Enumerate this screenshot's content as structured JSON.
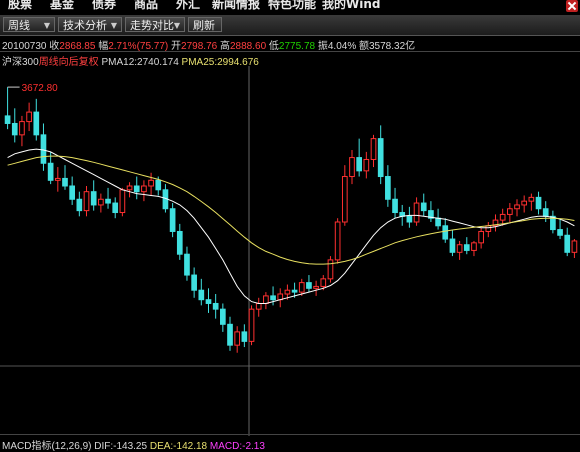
{
  "menu": [
    "股票",
    "基金",
    "债券",
    "商品",
    "外汇",
    "新闻情报",
    "特色功能",
    "我的Wind"
  ],
  "toolbar": {
    "period": "周线",
    "analysis": "技术分析",
    "compare": "走势对比",
    "refresh": "刷新"
  },
  "quote": {
    "date": "20100730",
    "close_label": "收",
    "close": "2868.85",
    "change_label": "幅",
    "change": "2.71%(75.77)",
    "open_label": "开",
    "open": "2798.76",
    "high_label": "高",
    "high": "2888.60",
    "low_label": "低",
    "low": "2775.78",
    "amp_label": "振",
    "amp": "4.04%",
    "amount_label": "额",
    "amount": "3578.32亿"
  },
  "indicator": {
    "name": "沪深300",
    "adjust": "周线向后复权",
    "pma12": "PMA12:2740.174",
    "pma25": "PMA25:2994.676"
  },
  "macd": {
    "label": "MACD指标(12,26,9)",
    "dif": "DIF:-143.25",
    "dea": "DEA:-142.18",
    "macd": "MACD:-2.13"
  },
  "chart_data": {
    "type": "candlestick",
    "title": "沪深300",
    "max_label": "3672.80",
    "colors": {
      "up": "#ff3030",
      "down": "#40e0e0",
      "ma12": "#ffffff",
      "ma25": "#e8e060",
      "crosshair": "#666666"
    },
    "ylim": [
      2200,
      3720
    ],
    "candles": [
      [
        3520,
        3672,
        3450,
        3480
      ],
      [
        3480,
        3560,
        3380,
        3420
      ],
      [
        3420,
        3520,
        3360,
        3490
      ],
      [
        3490,
        3590,
        3440,
        3540
      ],
      [
        3540,
        3610,
        3390,
        3420
      ],
      [
        3420,
        3480,
        3230,
        3270
      ],
      [
        3270,
        3330,
        3160,
        3180
      ],
      [
        3180,
        3250,
        3120,
        3190
      ],
      [
        3190,
        3260,
        3130,
        3150
      ],
      [
        3150,
        3200,
        3050,
        3080
      ],
      [
        3080,
        3120,
        2990,
        3020
      ],
      [
        3020,
        3150,
        2990,
        3120
      ],
      [
        3120,
        3180,
        3020,
        3050
      ],
      [
        3050,
        3110,
        3010,
        3080
      ],
      [
        3080,
        3140,
        3030,
        3060
      ],
      [
        3060,
        3090,
        2980,
        3010
      ],
      [
        3010,
        3140,
        2990,
        3130
      ],
      [
        3130,
        3170,
        3090,
        3150
      ],
      [
        3150,
        3200,
        3080,
        3120
      ],
      [
        3120,
        3180,
        3070,
        3150
      ],
      [
        3150,
        3220,
        3100,
        3180
      ],
      [
        3180,
        3200,
        3100,
        3130
      ],
      [
        3130,
        3160,
        3010,
        3030
      ],
      [
        3030,
        3060,
        2880,
        2910
      ],
      [
        2910,
        2950,
        2760,
        2790
      ],
      [
        2790,
        2830,
        2650,
        2680
      ],
      [
        2680,
        2720,
        2560,
        2600
      ],
      [
        2600,
        2660,
        2520,
        2550
      ],
      [
        2550,
        2610,
        2480,
        2530
      ],
      [
        2530,
        2580,
        2450,
        2500
      ],
      [
        2500,
        2530,
        2380,
        2420
      ],
      [
        2420,
        2460,
        2280,
        2310
      ],
      [
        2310,
        2410,
        2270,
        2380
      ],
      [
        2380,
        2420,
        2300,
        2330
      ],
      [
        2330,
        2520,
        2310,
        2500
      ],
      [
        2500,
        2560,
        2460,
        2530
      ],
      [
        2530,
        2590,
        2500,
        2570
      ],
      [
        2570,
        2620,
        2520,
        2550
      ],
      [
        2550,
        2610,
        2510,
        2580
      ],
      [
        2580,
        2630,
        2550,
        2600
      ],
      [
        2600,
        2640,
        2560,
        2590
      ],
      [
        2590,
        2660,
        2570,
        2640
      ],
      [
        2640,
        2680,
        2590,
        2610
      ],
      [
        2610,
        2650,
        2570,
        2620
      ],
      [
        2620,
        2680,
        2600,
        2660
      ],
      [
        2660,
        2780,
        2640,
        2760
      ],
      [
        2760,
        2980,
        2740,
        2960
      ],
      [
        2960,
        3260,
        2940,
        3200
      ],
      [
        3200,
        3340,
        3160,
        3300
      ],
      [
        3300,
        3400,
        3200,
        3230
      ],
      [
        3230,
        3330,
        3190,
        3290
      ],
      [
        3290,
        3420,
        3250,
        3400
      ],
      [
        3400,
        3470,
        3160,
        3200
      ],
      [
        3200,
        3260,
        3040,
        3080
      ],
      [
        3080,
        3140,
        2980,
        3010
      ],
      [
        3010,
        3050,
        2940,
        2990
      ],
      [
        2990,
        3040,
        2930,
        2960
      ],
      [
        2960,
        3090,
        2940,
        3060
      ],
      [
        3060,
        3110,
        2990,
        3020
      ],
      [
        3020,
        3070,
        2960,
        2980
      ],
      [
        2980,
        3030,
        2920,
        2940
      ],
      [
        2940,
        2980,
        2850,
        2870
      ],
      [
        2870,
        2920,
        2780,
        2800
      ],
      [
        2800,
        2860,
        2760,
        2840
      ],
      [
        2840,
        2880,
        2790,
        2810
      ],
      [
        2810,
        2860,
        2780,
        2850
      ],
      [
        2850,
        2930,
        2820,
        2910
      ],
      [
        2910,
        2960,
        2880,
        2940
      ],
      [
        2940,
        3000,
        2910,
        2970
      ],
      [
        2970,
        3030,
        2940,
        3000
      ],
      [
        3000,
        3060,
        2960,
        3030
      ],
      [
        3030,
        3080,
        2990,
        3050
      ],
      [
        3050,
        3100,
        3010,
        3070
      ],
      [
        3070,
        3110,
        3020,
        3090
      ],
      [
        3090,
        3120,
        3000,
        3030
      ],
      [
        3030,
        3070,
        2960,
        2990
      ],
      [
        2990,
        3020,
        2900,
        2920
      ],
      [
        2920,
        2980,
        2870,
        2890
      ],
      [
        2890,
        2930,
        2780,
        2800
      ],
      [
        2800,
        2870,
        2770,
        2860
      ]
    ],
    "ma12": [
      3300,
      3320,
      3330,
      3340,
      3345,
      3340,
      3330,
      3310,
      3290,
      3270,
      3250,
      3230,
      3210,
      3190,
      3170,
      3150,
      3130,
      3120,
      3110,
      3105,
      3100,
      3095,
      3085,
      3070,
      3050,
      3020,
      2980,
      2930,
      2880,
      2820,
      2760,
      2690,
      2620,
      2570,
      2540,
      2530,
      2530,
      2540,
      2550,
      2560,
      2570,
      2580,
      2590,
      2600,
      2610,
      2625,
      2650,
      2690,
      2740,
      2790,
      2840,
      2890,
      2930,
      2960,
      2980,
      2990,
      2995,
      2995,
      2990,
      2985,
      2980,
      2975,
      2965,
      2955,
      2945,
      2935,
      2930,
      2930,
      2935,
      2945,
      2955,
      2965,
      2975,
      2985,
      2990,
      2990,
      2985,
      2975,
      2960,
      2940
    ],
    "ma25": [
      3260,
      3270,
      3280,
      3290,
      3300,
      3305,
      3308,
      3308,
      3305,
      3300,
      3292,
      3284,
      3275,
      3265,
      3255,
      3245,
      3235,
      3225,
      3215,
      3205,
      3195,
      3185,
      3172,
      3158,
      3140,
      3120,
      3095,
      3068,
      3040,
      3010,
      2978,
      2945,
      2912,
      2880,
      2850,
      2825,
      2805,
      2790,
      2775,
      2762,
      2752,
      2745,
      2740,
      2738,
      2738,
      2740,
      2745,
      2752,
      2762,
      2775,
      2790,
      2805,
      2820,
      2835,
      2850,
      2862,
      2872,
      2882,
      2890,
      2898,
      2905,
      2912,
      2918,
      2923,
      2928,
      2932,
      2936,
      2940,
      2945,
      2950,
      2956,
      2962,
      2968,
      2974,
      2978,
      2980,
      2980,
      2978,
      2974,
      2968
    ]
  }
}
